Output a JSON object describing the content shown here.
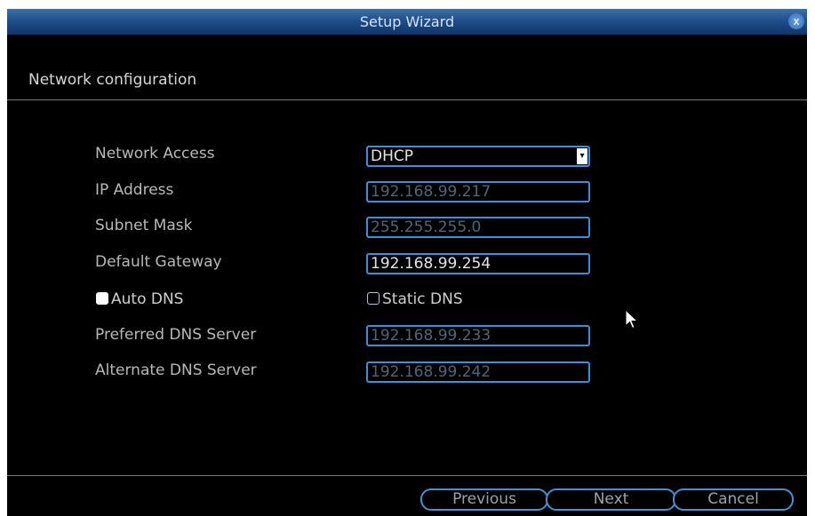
{
  "window": {
    "title": "Setup Wizard",
    "close_label": "x"
  },
  "section": {
    "title": "Network configuration"
  },
  "fields": {
    "network_access": {
      "label": "Network Access",
      "value": "DHCP",
      "arrow": "▾"
    },
    "ip_address": {
      "label": "IP Address",
      "value": "192.168.99.217"
    },
    "subnet_mask": {
      "label": "Subnet Mask",
      "value": "255.255.255.0"
    },
    "default_gateway": {
      "label": "Default Gateway",
      "value": "192.168.99.254"
    },
    "preferred_dns": {
      "label": "Preferred DNS Server",
      "value": "192.168.99.233"
    },
    "alternate_dns": {
      "label": "Alternate DNS Server",
      "value": "192.168.99.242"
    }
  },
  "dns_mode": {
    "auto": {
      "label": "Auto DNS",
      "checked": true
    },
    "static": {
      "label": "Static DNS",
      "checked": false
    }
  },
  "buttons": {
    "previous": "Previous",
    "next": "Next",
    "cancel": "Cancel"
  },
  "colors": {
    "accent": "#3f8fd8",
    "title_bar": "#1e4f8c",
    "background": "#000000",
    "disabled_text": "#4f6579"
  },
  "icons": {
    "close": "close-icon",
    "dropdown": "chevron-down-icon",
    "cursor": "mouse-pointer-icon"
  }
}
